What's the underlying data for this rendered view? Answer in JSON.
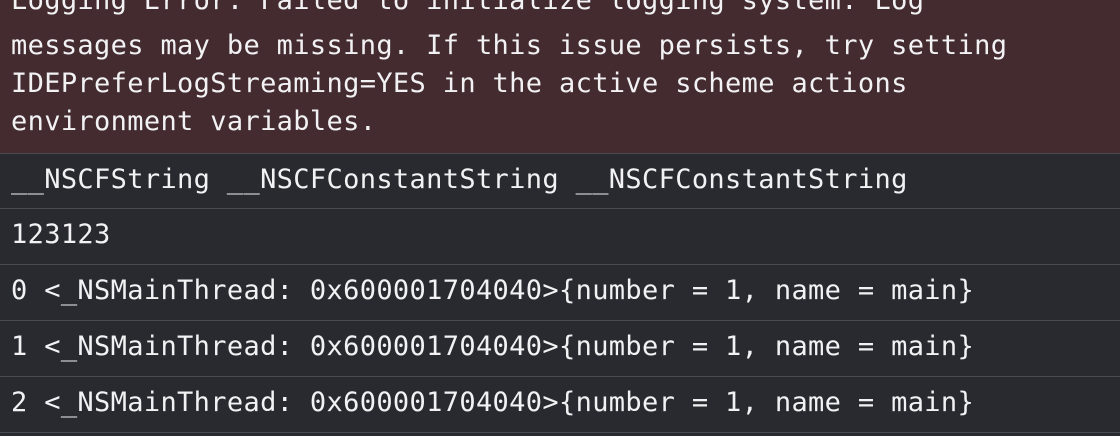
{
  "console": {
    "error": {
      "lines": [
        "Logging Error: Failed to initialize logging system. Log",
        "messages may be missing. If this issue persists, try setting",
        "IDEPreferLogStreaming=YES in the active scheme actions",
        "environment variables."
      ],
      "background_color": "#432b30"
    },
    "entries": [
      "__NSCFString __NSCFConstantString __NSCFConstantString",
      "123123",
      "0 <_NSMainThread: 0x600001704040>{number = 1, name = main}",
      "1 <_NSMainThread: 0x600001704040>{number = 1, name = main}",
      "2 <_NSMainThread: 0x600001704040>{number = 1, name = main}"
    ],
    "background_color": "#292a30",
    "text_color": "#f2f2f4"
  }
}
